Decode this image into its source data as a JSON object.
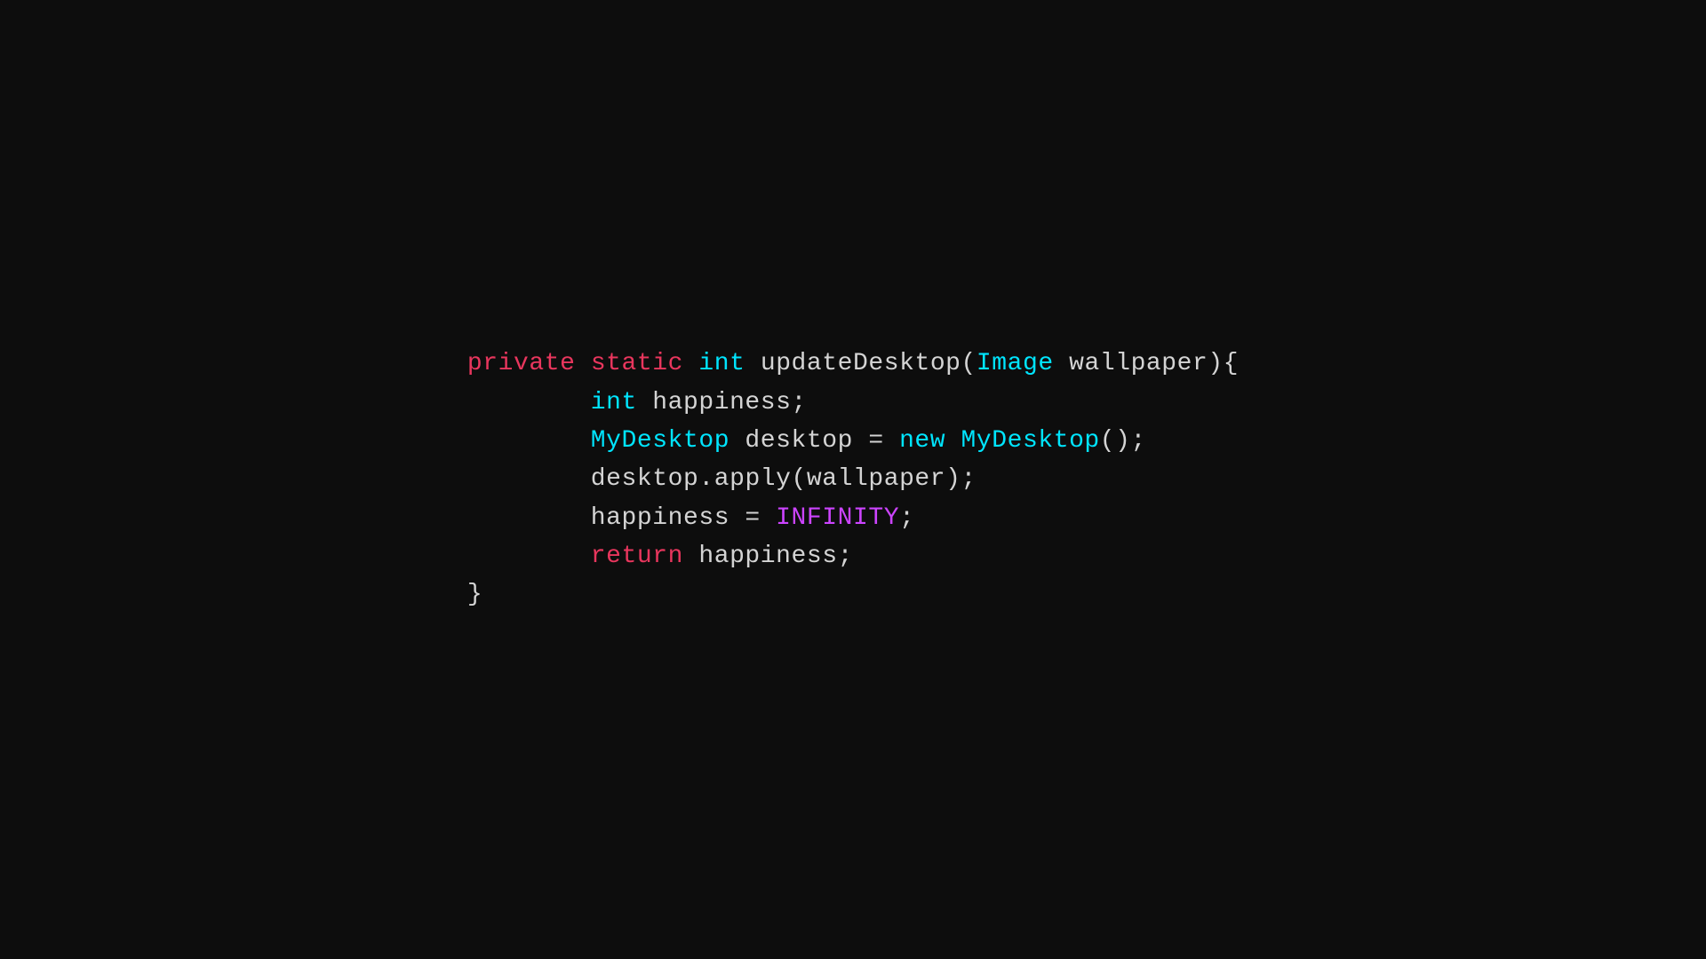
{
  "code": {
    "lines": [
      {
        "id": "line1",
        "parts": [
          {
            "text": "private",
            "cls": "keyword-private"
          },
          {
            "text": " ",
            "cls": "plain"
          },
          {
            "text": "static",
            "cls": "keyword-static"
          },
          {
            "text": " ",
            "cls": "plain"
          },
          {
            "text": "int",
            "cls": "keyword-int"
          },
          {
            "text": " updateDesktop(",
            "cls": "plain"
          },
          {
            "text": "Image",
            "cls": "class-image"
          },
          {
            "text": " wallpaper){",
            "cls": "plain"
          }
        ]
      },
      {
        "id": "line2",
        "parts": [
          {
            "text": "        ",
            "cls": "plain"
          },
          {
            "text": "int",
            "cls": "keyword-int"
          },
          {
            "text": " happiness;",
            "cls": "plain"
          }
        ]
      },
      {
        "id": "line3",
        "parts": [
          {
            "text": "        ",
            "cls": "plain"
          },
          {
            "text": "MyDesktop",
            "cls": "class-name"
          },
          {
            "text": " desktop = ",
            "cls": "plain"
          },
          {
            "text": "new",
            "cls": "keyword-new"
          },
          {
            "text": " ",
            "cls": "plain"
          },
          {
            "text": "MyDesktop",
            "cls": "class-name"
          },
          {
            "text": "();",
            "cls": "plain"
          }
        ]
      },
      {
        "id": "line4",
        "parts": [
          {
            "text": "        desktop",
            "cls": "plain"
          },
          {
            "text": ".",
            "cls": "dot"
          },
          {
            "text": "apply(wallpaper);",
            "cls": "plain"
          }
        ]
      },
      {
        "id": "line5",
        "parts": [
          {
            "text": "        happiness = ",
            "cls": "plain"
          },
          {
            "text": "INFINITY",
            "cls": "constant"
          },
          {
            "text": ";",
            "cls": "plain"
          }
        ]
      },
      {
        "id": "line6",
        "parts": [
          {
            "text": "        ",
            "cls": "plain"
          },
          {
            "text": "return",
            "cls": "keyword-return"
          },
          {
            "text": " happiness;",
            "cls": "plain"
          }
        ]
      },
      {
        "id": "line7",
        "parts": [
          {
            "text": "}",
            "cls": "plain"
          }
        ]
      }
    ]
  }
}
